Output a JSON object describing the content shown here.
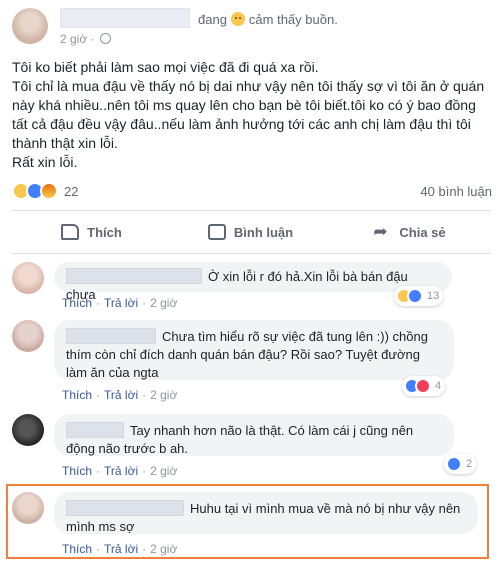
{
  "post": {
    "feeling_prefix": "đang",
    "feeling_text": "cảm thấy buồn.",
    "time": "2 giờ ·",
    "body": [
      "Tôi ko biết phải làm sao mọi việc đã đi quá xa rồi.",
      "Tôi chỉ là mua đậu về thấy nó bị dai như vậy nên tôi thấy sợ vì tôi ăn ở quán này khá nhiều..nên tôi ms quay lên cho bạn bè tôi biết.tôi ko có ý bao đồng tất cả đậu đều vậy đâu..nếu làm ảnh hưởng tới các anh chị làm đậu thì tôi thành thật xin lỗi.",
      "Rất xin lỗi."
    ],
    "reaction_count": "22",
    "comments_count": "40 bình luận"
  },
  "actions": {
    "like": "Thích",
    "comment": "Bình luận",
    "share": "Chia sẻ"
  },
  "comment_actions": {
    "like": "Thích",
    "reply": "Trả lời",
    "time": "2 giờ"
  },
  "comments": [
    {
      "text": "Ờ xin lỗi r đó hả.Xin lỗi bà bán đậu chưa",
      "reactions": "13",
      "reaction_icons": [
        "haha-icon",
        "like-icon"
      ]
    },
    {
      "text": "Chưa tìm hiểu rõ sự việc đã tung lên :)) chồng thím còn chỉ đích danh quán bán đậu? Rồi sao? Tuyệt đường làm ăn của ngta",
      "reactions": "4",
      "reaction_icons": [
        "like-icon",
        "love-icon"
      ]
    },
    {
      "text": "Tay nhanh hơn não là thật. Có làm cái j cũng nên động não trước b ah.",
      "reactions": "2",
      "reaction_icons": [
        "like-icon"
      ]
    },
    {
      "text": "Huhu tại vì mình mua về mà nó bị như vậy nên mình ms sợ",
      "reactions": "",
      "reaction_icons": []
    }
  ],
  "colors": {
    "link": "#385898",
    "highlight": "#f07f3a",
    "bubble": "#f2f3f5"
  }
}
